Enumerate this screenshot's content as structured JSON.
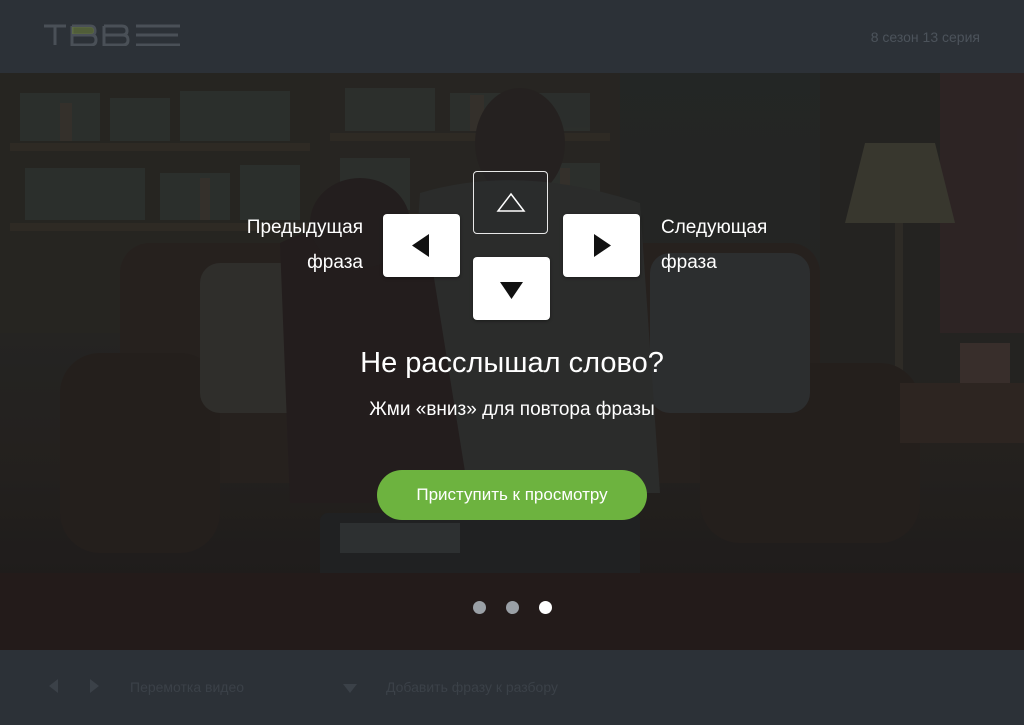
{
  "header": {
    "logo_text": "ТВВЕ",
    "episode": "8 сезон 13 серия"
  },
  "tutorial": {
    "prev_line1": "Предыдущая",
    "prev_line2": "фраза",
    "next_line1": "Следующая",
    "next_line2": "фраза",
    "title": "Не расслышал слово?",
    "subtitle": "Жми «вниз» для повтора фразы",
    "start_button": "Приступить к просмотру",
    "pager": {
      "total": 3,
      "active": 3
    }
  },
  "footer": {
    "seek_label": "Перемотка видео",
    "add_phrase_label": "Добавить фразу к разбору"
  },
  "colors": {
    "accent": "#6db33f",
    "header_bg": "#2c3137",
    "dot_inactive": "#9aa0a6",
    "dot_active": "#ffffff"
  }
}
